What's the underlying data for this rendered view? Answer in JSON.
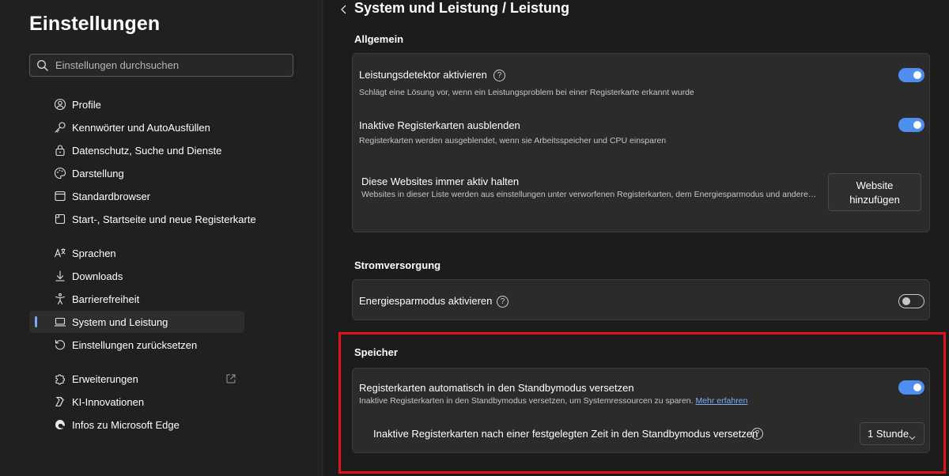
{
  "sidebar": {
    "title": "Einstellungen",
    "search": {
      "placeholder": "Einstellungen durchsuchen"
    },
    "items": [
      {
        "label": "Profile",
        "icon": "profile-icon"
      },
      {
        "label": "Kennwörter und AutoAusfüllen",
        "icon": "key-icon"
      },
      {
        "label": "Datenschutz, Suche und Dienste",
        "icon": "lock-icon"
      },
      {
        "label": "Darstellung",
        "icon": "appearance-icon"
      },
      {
        "label": "Standardbrowser",
        "icon": "browser-icon"
      },
      {
        "label": "Start-, Startseite und neue Registerkarte",
        "icon": "newtab-icon"
      },
      {
        "label": "Sprachen",
        "icon": "language-icon"
      },
      {
        "label": "Downloads",
        "icon": "download-icon"
      },
      {
        "label": "Barrierefreiheit",
        "icon": "accessibility-icon"
      },
      {
        "label": "System und Leistung",
        "icon": "laptop-icon",
        "active": true
      },
      {
        "label": "Einstellungen zurücksetzen",
        "icon": "reset-icon"
      },
      {
        "label": "Erweiterungen",
        "icon": "extension-icon",
        "external": true
      },
      {
        "label": "KI-Innovationen",
        "icon": "ai-icon"
      },
      {
        "label": "Infos zu Microsoft Edge",
        "icon": "edge-icon"
      }
    ]
  },
  "main": {
    "breadcrumb": "System und Leistung / Leistung",
    "sections": {
      "general": {
        "title": "Allgemein",
        "perf_detector": {
          "title": "Leistungsdetektor aktivieren",
          "desc": "Schlägt eine Lösung vor, wenn ein Leistungsproblem bei einer Registerkarte erkannt wurde",
          "enabled": true
        },
        "hide_inactive": {
          "title": "Inaktive Registerkarten ausblenden",
          "desc": "Registerkarten werden ausgeblendet, wenn sie Arbeitsspeicher und CPU einsparen",
          "enabled": true
        },
        "always_active": {
          "title": "Diese Websites immer aktiv halten",
          "desc": "Websites in dieser Liste werden aus einstellungen unter verworfenen Registerkarten, dem Energiesparmodus und andere…",
          "button_line1": "Website",
          "button_line2": "hinzufügen"
        }
      },
      "power": {
        "title": "Stromversorgung",
        "energy_saver": {
          "title": "Energiesparmodus aktivieren",
          "enabled": false
        }
      },
      "memory": {
        "title": "Speicher",
        "sleeping_tabs": {
          "title": "Registerkarten automatisch in den Standbymodus versetzen",
          "desc": "Inaktive Registerkarten in den Standbymodus versetzen, um Systemressourcen zu sparen.",
          "link": "Mehr erfahren",
          "enabled": true
        },
        "sleep_after": {
          "title": "Inaktive Registerkarten nach einer festgelegten Zeit in den Standbymodus versetzen",
          "value": "1 Stunde"
        }
      }
    }
  },
  "colors": {
    "accent": "#4d8ef0",
    "highlight": "#e0141c",
    "background": "#1c1c1c",
    "card": "#2b2b2b"
  }
}
